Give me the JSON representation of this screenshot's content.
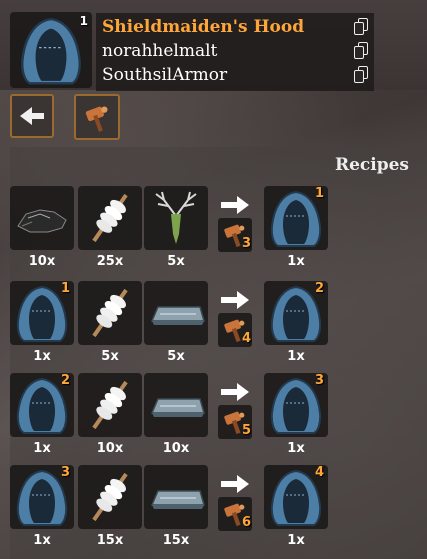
{
  "header": {
    "item_icon": "shieldmaidens-hood-icon",
    "item_count": "1",
    "names": [
      {
        "label": "Shieldmaiden's Hood",
        "active": true
      },
      {
        "label": "norahhelmalt",
        "active": false
      },
      {
        "label": "SouthsilArmor",
        "active": false
      }
    ],
    "copy_icon": "copy-icon"
  },
  "toolbar": {
    "back_icon": "back-arrow-icon",
    "station_icon": "forge-hammer-icon"
  },
  "recipes": {
    "title": "Recipes",
    "rows": [
      {
        "inputs": [
          {
            "icon": "coal-icon",
            "qty": "10x",
            "level": ""
          },
          {
            "icon": "thread-spool-icon",
            "qty": "25x",
            "level": ""
          },
          {
            "icon": "antler-trophy-icon",
            "qty": "5x",
            "level": ""
          }
        ],
        "station_level": "3",
        "output": {
          "icon": "shieldmaidens-hood-icon",
          "qty": "1x",
          "level": "1"
        }
      },
      {
        "inputs": [
          {
            "icon": "shieldmaidens-hood-icon",
            "qty": "1x",
            "level": "1"
          },
          {
            "icon": "thread-spool-icon",
            "qty": "5x",
            "level": ""
          },
          {
            "icon": "metal-bar-icon",
            "qty": "5x",
            "level": ""
          }
        ],
        "station_level": "4",
        "output": {
          "icon": "shieldmaidens-hood-icon",
          "qty": "1x",
          "level": "2"
        }
      },
      {
        "inputs": [
          {
            "icon": "shieldmaidens-hood-icon",
            "qty": "1x",
            "level": "2"
          },
          {
            "icon": "thread-spool-icon",
            "qty": "10x",
            "level": ""
          },
          {
            "icon": "metal-bar-icon",
            "qty": "10x",
            "level": ""
          }
        ],
        "station_level": "5",
        "output": {
          "icon": "shieldmaidens-hood-icon",
          "qty": "1x",
          "level": "3"
        }
      },
      {
        "inputs": [
          {
            "icon": "shieldmaidens-hood-icon",
            "qty": "1x",
            "level": "3"
          },
          {
            "icon": "thread-spool-icon",
            "qty": "15x",
            "level": ""
          },
          {
            "icon": "metal-bar-icon",
            "qty": "15x",
            "level": ""
          }
        ],
        "station_level": "6",
        "output": {
          "icon": "shieldmaidens-hood-icon",
          "qty": "1x",
          "level": "4"
        }
      }
    ]
  },
  "colors": {
    "accent_orange": "#ffa63a",
    "hood_blue": "#4d7fa6",
    "panel_dark": "#1f1b1b"
  }
}
